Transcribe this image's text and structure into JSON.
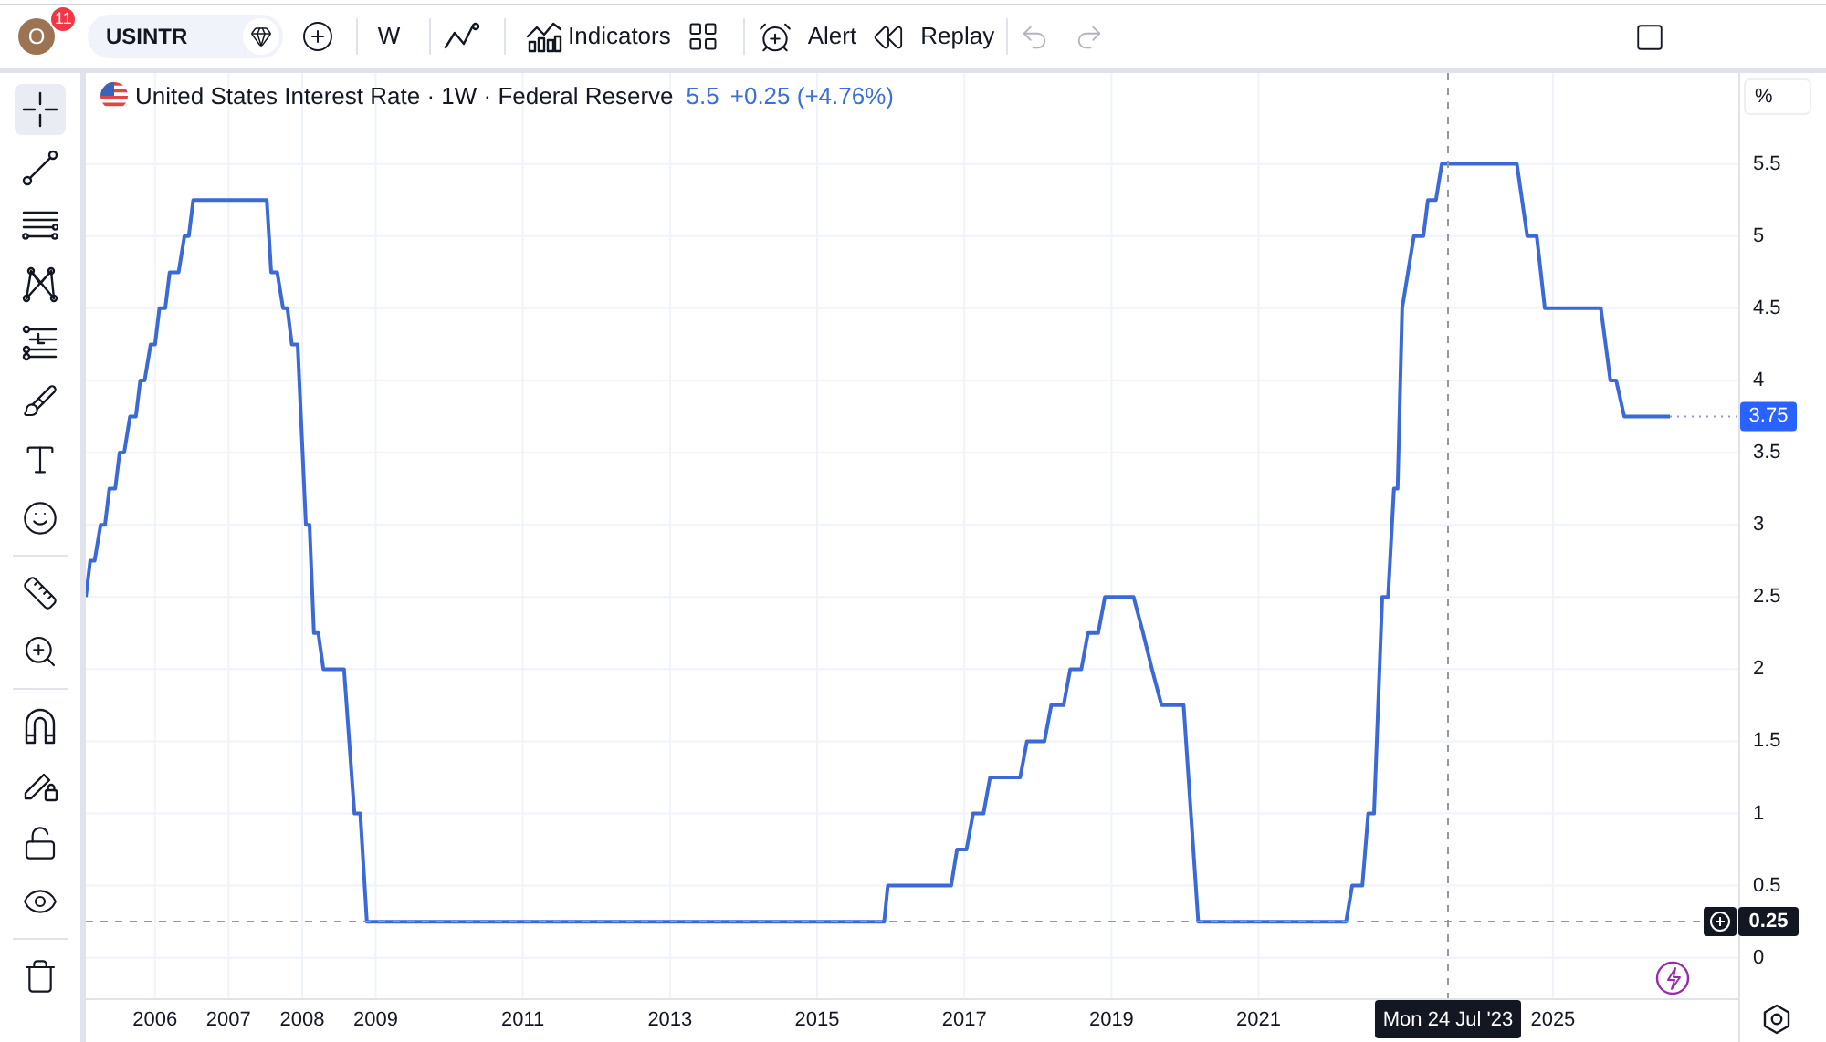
{
  "toolbar": {
    "avatar": {
      "initial": "O",
      "badge": "11"
    },
    "symbol": "USINTR",
    "interval": "W",
    "indicators_label": "Indicators",
    "alert_label": "Alert",
    "replay_label": "Replay",
    "undo": {
      "disabled": true
    },
    "redo": {
      "disabled": true
    }
  },
  "drawing_toolbar": {
    "groups": [
      {
        "tools": [
          {
            "selected": true
          },
          {
            "selected": false
          },
          {
            "selected": false
          },
          {
            "selected": false
          },
          {
            "selected": false
          },
          {
            "selected": false
          },
          {
            "selected": false
          },
          {
            "selected": false
          }
        ]
      },
      {
        "tools": [
          {
            "selected": false
          },
          {
            "selected": false
          }
        ]
      },
      {
        "tools": [
          {
            "selected": false
          },
          {
            "selected": false
          },
          {
            "selected": false
          },
          {
            "selected": false
          }
        ]
      },
      {
        "tools": [
          {
            "selected": false
          }
        ]
      }
    ]
  },
  "chart": {
    "legend": {
      "title": "United States Interest Rate · 1W · Federal Reserve",
      "value": "5.5",
      "change": "+0.25 (+4.76%)"
    },
    "last_price_label": "3.75",
    "crosshair": {
      "time_label": "Mon 24 Jul '23",
      "price_label": "0.25"
    },
    "chart_data": {
      "type": "line",
      "ylabel": "%",
      "x": [
        2005.06,
        2005.12,
        2005.18,
        2005.26,
        2005.32,
        2005.38,
        2005.46,
        2005.52,
        2005.58,
        2005.66,
        2005.74,
        2005.8,
        2005.86,
        2005.94,
        2006,
        2006.06,
        2006.14,
        2006.2,
        2006.32,
        2006.4,
        2006.46,
        2006.52,
        2007.52,
        2007.58,
        2007.66,
        2007.74,
        2007.8,
        2007.86,
        2007.94,
        2008.05,
        2008.1,
        2008.16,
        2008.22,
        2008.29,
        2008.57,
        2008.71,
        2008.79,
        2008.88,
        2015.91,
        2015.96,
        2016.82,
        2016.9,
        2017.03,
        2017.12,
        2017.26,
        2017.35,
        2017.76,
        2017.85,
        2018.09,
        2018.18,
        2018.35,
        2018.44,
        2018.59,
        2018.68,
        2018.82,
        2018.91,
        2019.3,
        2019.43,
        2019.55,
        2019.68,
        2019.98,
        2020.18,
        2022.19,
        2022.27,
        2022.41,
        2022.49,
        2022.57,
        2022.68,
        2022.76,
        2022.84,
        2022.89,
        2022.95,
        2023.03,
        2023.11,
        2023.24,
        2023.3,
        2023.41,
        2023.49,
        2024.51,
        2024.65,
        2024.78,
        2024.89,
        2025.65,
        2025.78,
        2025.86,
        2025.97,
        2026.59
      ],
      "series": [
        {
          "color": "#3b6ad6",
          "values": [
            2.5,
            2.75,
            2.75,
            3,
            3,
            3.25,
            3.25,
            3.5,
            3.5,
            3.75,
            3.75,
            4,
            4,
            4.25,
            4.25,
            4.5,
            4.5,
            4.75,
            4.75,
            5,
            5,
            5.25,
            5.25,
            4.75,
            4.75,
            4.5,
            4.5,
            4.25,
            4.25,
            3,
            3,
            2.25,
            2.25,
            2,
            2,
            1,
            1,
            0.25,
            0.25,
            0.5,
            0.5,
            0.75,
            0.75,
            1,
            1,
            1.25,
            1.25,
            1.5,
            1.5,
            1.75,
            1.75,
            2,
            2,
            2.25,
            2.25,
            2.5,
            2.5,
            2.25,
            2,
            1.75,
            1.75,
            0.25,
            0.25,
            0.5,
            0.5,
            1,
            1,
            2.5,
            2.5,
            3.25,
            3.25,
            4.5,
            4.75,
            5,
            5,
            5.25,
            5.25,
            5.5,
            5.5,
            5,
            5,
            4.5,
            4.5,
            4,
            4,
            3.75,
            3.75
          ]
        }
      ],
      "xlim": [
        2005.06,
        2027.52
      ],
      "ylim": [
        -0.28,
        6.13
      ],
      "grid": true,
      "xticks": [
        2006,
        2007,
        2008,
        2009,
        2011,
        2013,
        2015,
        2017,
        2019,
        2021,
        2025
      ],
      "yticks": [
        0,
        0.5,
        1,
        1.5,
        2,
        2.5,
        3,
        3.5,
        4,
        4.5,
        5,
        5.5
      ]
    }
  }
}
